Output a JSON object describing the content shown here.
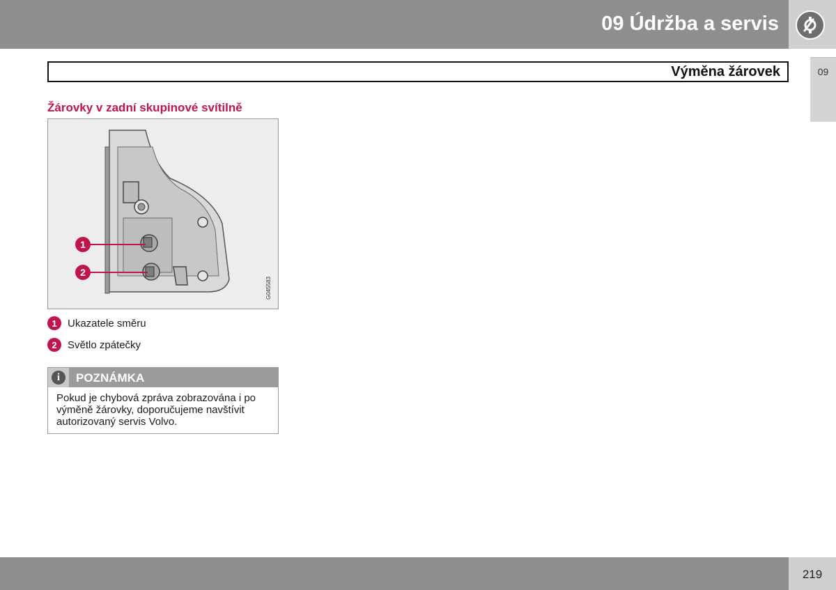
{
  "header": {
    "chapter_title": "09 Údržba a servis",
    "icon": "wrench-gear-icon"
  },
  "side_tab": {
    "label": "09"
  },
  "section": {
    "title": "Výměna žárovek"
  },
  "subheading": "Žárovky v zadní skupinové svítilně",
  "figure": {
    "code": "G045583",
    "callouts": [
      "1",
      "2"
    ],
    "accent_color": "#c0154a"
  },
  "legend": [
    {
      "num": "1",
      "label": "Ukazatele směru"
    },
    {
      "num": "2",
      "label": "Světlo zpátečky"
    }
  ],
  "note": {
    "icon": "info-icon",
    "icon_glyph": "i",
    "title": "POZNÁMKA",
    "body": "Pokud je chybová zpráva zobrazována i po výměně žárovky, doporučujeme navštívit autorizovaný servis Volvo."
  },
  "footer": {
    "page_number": "219"
  }
}
